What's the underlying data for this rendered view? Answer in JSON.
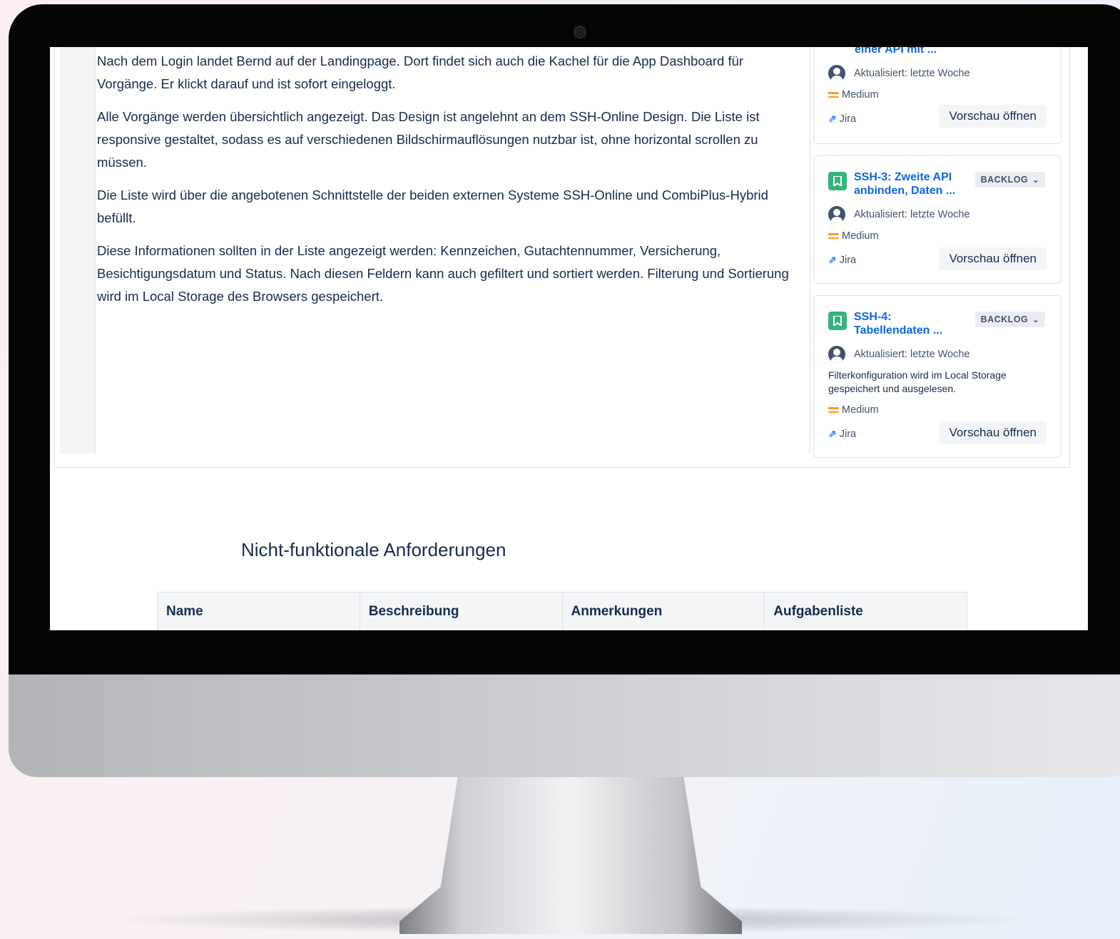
{
  "description": {
    "paragraphs": [
      "Nach dem Login landet Bernd auf der Landingpage. Dort findet sich auch die Kachel für die App Dashboard für Vorgänge. Er klickt darauf und ist sofort eingeloggt.",
      "Alle Vorgänge werden übersichtlich angezeigt. Das Design ist angelehnt an dem SSH-Online Design. Die Liste ist responsive gestaltet, sodass es auf verschiedenen Bildschirmauflösungen nutzbar ist, ohne horizontal scrollen zu müssen.",
      "Die Liste wird über die angebotenen Schnittstelle der beiden externen Systeme SSH-Online und CombiPlus-Hybrid befüllt.",
      "Diese Informationen sollten in der Liste angezeigt werden: Kennzeichen, Gutachtennummer, Versicherung, Besichtigungsdatum und Status. Nach diesen Feldern kann auch gefiltert und sortiert werden. Filterung und Sortierung wird im Local Storage des Browsers gespeichert."
    ]
  },
  "cards": [
    {
      "title": "einer API mit ...",
      "updated": "Aktualisiert: letzte Woche",
      "priority": "Medium",
      "source": "Jira",
      "preview_label": "Vorschau öffnen"
    },
    {
      "title": "SSH-3: Zweite API anbinden, Daten ...",
      "status": "BACKLOG",
      "updated": "Aktualisiert: letzte Woche",
      "priority": "Medium",
      "source": "Jira",
      "preview_label": "Vorschau öffnen"
    },
    {
      "title": "SSH-4: Tabellendaten ...",
      "status": "BACKLOG",
      "updated": "Aktualisiert: letzte Woche",
      "description": "Filterkonfiguration wird im Local Storage gespeichert und ausgelesen.",
      "priority": "Medium",
      "source": "Jira",
      "preview_label": "Vorschau öffnen"
    }
  ],
  "section": {
    "title": "Nicht-funktionale Anforderungen"
  },
  "table": {
    "headers": [
      "Name",
      "Beschreibung",
      "Anmerkungen",
      "Aufgabenliste"
    ]
  },
  "colors": {
    "link_blue": "#0c66e4",
    "story_green": "#36b37e",
    "priority_orange": "#ff991f",
    "text_dark": "#172b4d"
  }
}
